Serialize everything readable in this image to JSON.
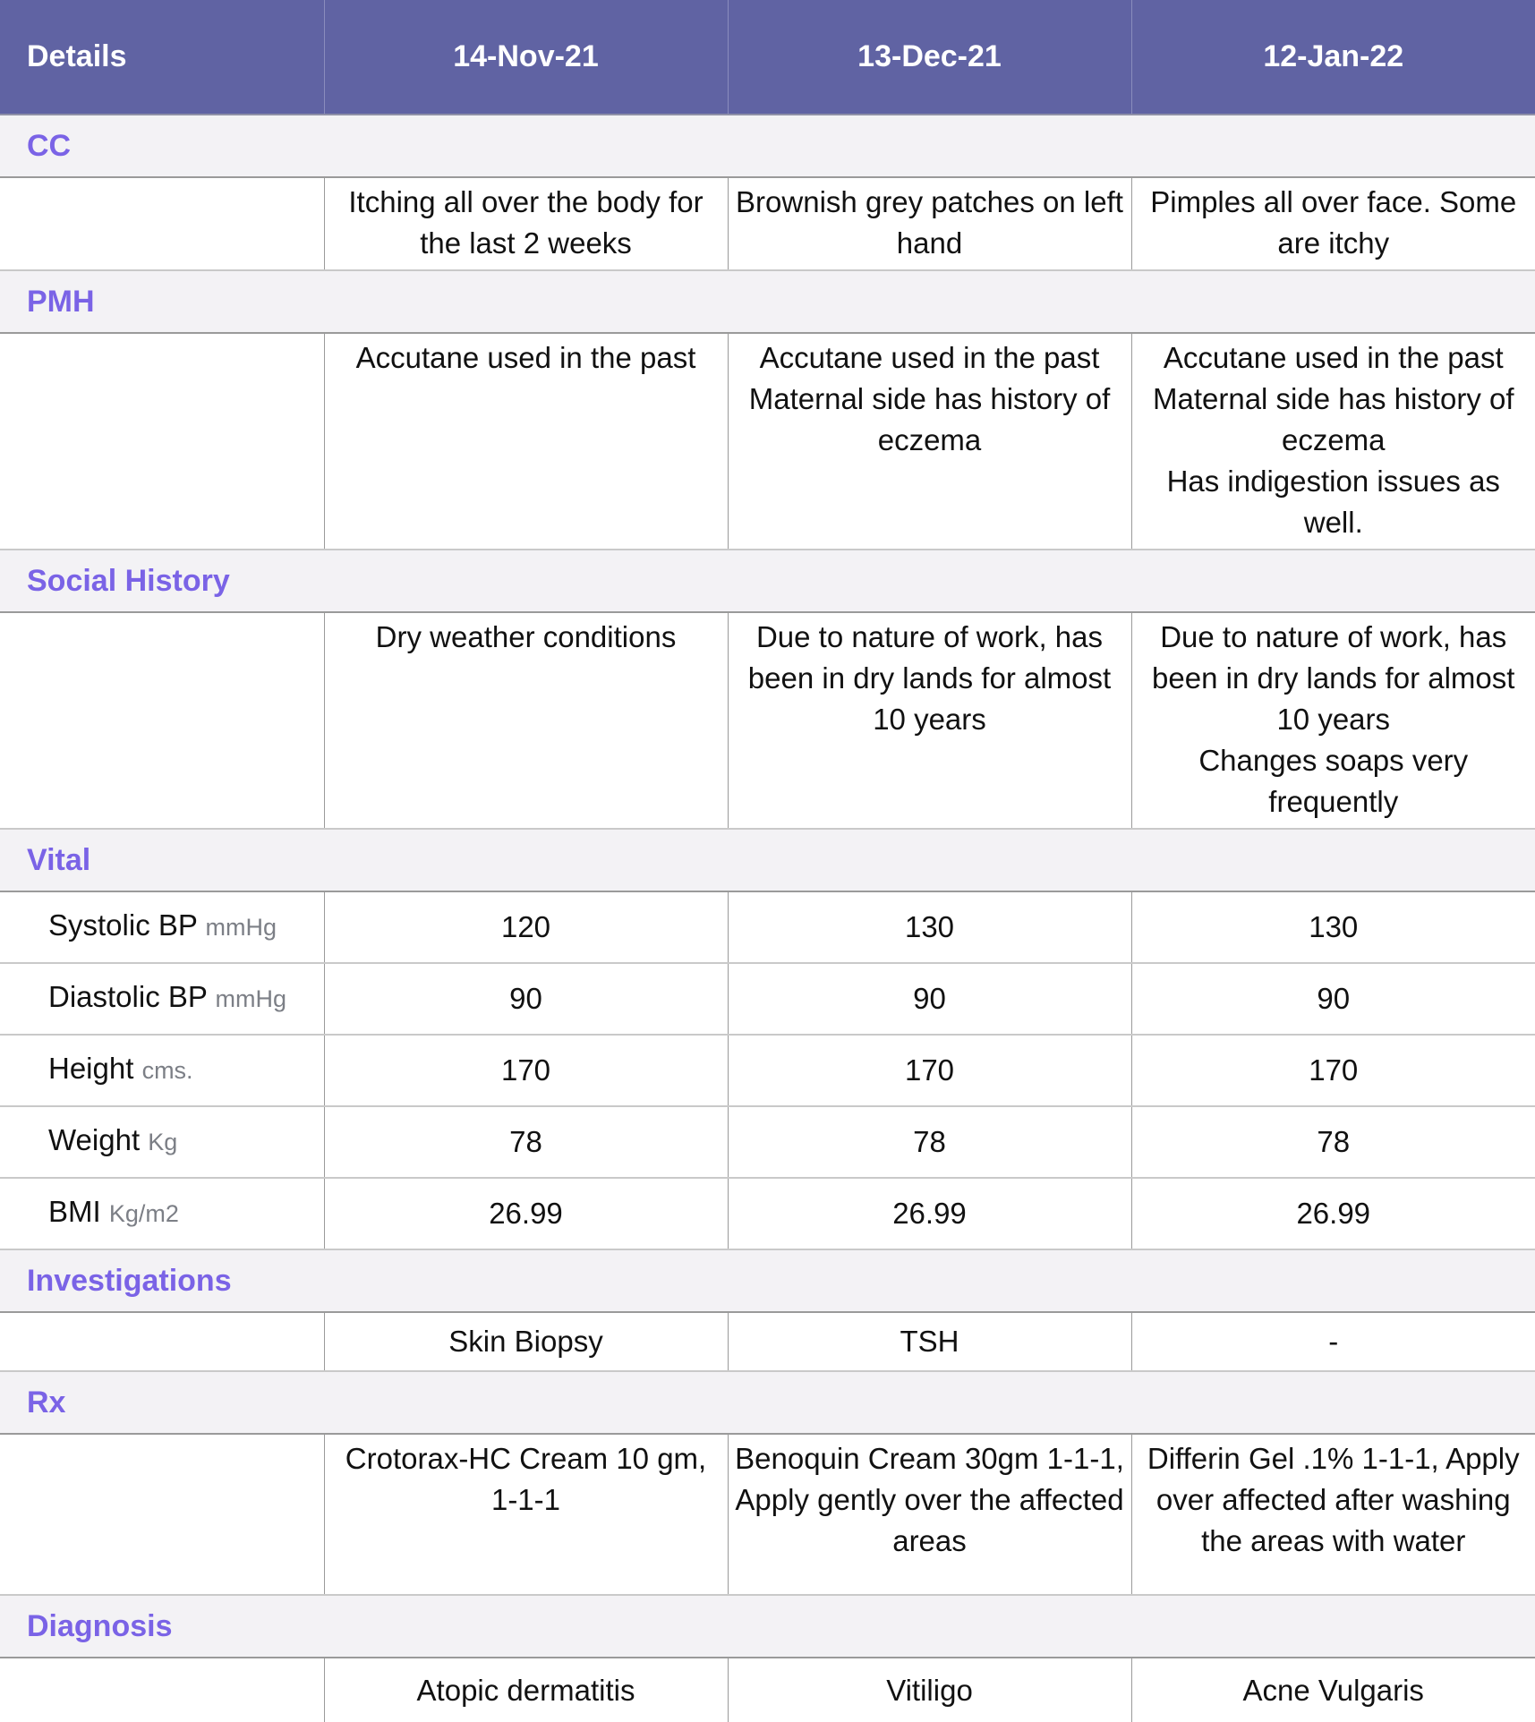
{
  "header": {
    "details_label": "Details",
    "dates": [
      "14-Nov-21",
      "13-Dec-21",
      "12-Jan-22"
    ]
  },
  "sections": {
    "cc": {
      "title": "CC",
      "values": [
        [
          "Itching all over the body for the last 2 weeks"
        ],
        [
          "Brownish grey patches on left hand"
        ],
        [
          "Pimples all over face. Some are itchy"
        ]
      ]
    },
    "pmh": {
      "title": "PMH",
      "values": [
        [
          "Accutane used in the past"
        ],
        [
          "Accutane used in the past",
          "Maternal side has history of eczema"
        ],
        [
          "Accutane used in the past",
          "Maternal side has history of eczema",
          "Has indigestion issues as well."
        ]
      ]
    },
    "social": {
      "title": "Social History",
      "values": [
        [
          "Dry weather conditions"
        ],
        [
          "Due to nature of work, has been in dry lands for almost 10 years"
        ],
        [
          "Due to nature of work, has been in dry lands for almost 10 years",
          "Changes soaps very frequently"
        ]
      ]
    },
    "vital": {
      "title": "Vital",
      "rows": [
        {
          "label": "Systolic BP",
          "unit": "mmHg",
          "values": [
            "120",
            "130",
            "130"
          ]
        },
        {
          "label": "Diastolic BP",
          "unit": "mmHg",
          "values": [
            "90",
            "90",
            "90"
          ]
        },
        {
          "label": "Height",
          "unit": "cms.",
          "values": [
            "170",
            "170",
            "170"
          ]
        },
        {
          "label": "Weight",
          "unit": "Kg",
          "values": [
            "78",
            "78",
            "78"
          ]
        },
        {
          "label": "BMI",
          "unit": "Kg/m2",
          "values": [
            "26.99",
            "26.99",
            "26.99"
          ]
        }
      ]
    },
    "investigations": {
      "title": "Investigations",
      "values": [
        "Skin Biopsy",
        "TSH",
        "-"
      ]
    },
    "rx": {
      "title": "Rx",
      "values": [
        "Crotorax-HC Cream 10 gm, 1-1-1",
        "Benoquin Cream 30gm 1-1-1, Apply gently over the affected areas",
        "Differin Gel .1% 1-1-1, Apply over affected after washing the areas with water"
      ]
    },
    "diagnosis": {
      "title": "Diagnosis",
      "values": [
        "Atopic dermatitis",
        "Vitiligo",
        "Acne Vulgaris"
      ]
    }
  },
  "colors": {
    "header_bg": "#6063a3",
    "section_title": "#7a63e6",
    "section_bg": "#f3f2f5"
  }
}
